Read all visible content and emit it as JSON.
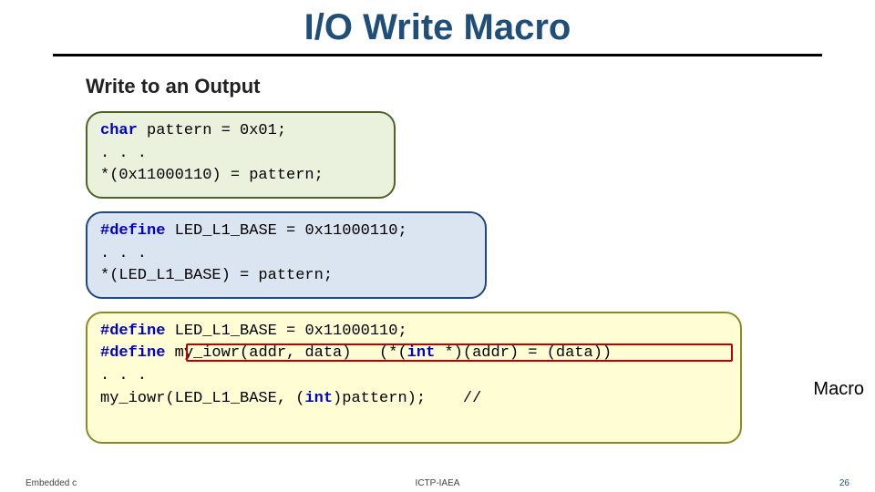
{
  "title": "I/O  Write Macro",
  "subhead": "Write to an Output",
  "code1": {
    "kw": "char",
    "rest1": " pattern = 0x01;",
    "line2": ". . .",
    "line3": "*(0x11000110) = pattern;"
  },
  "code2": {
    "kw": "#define",
    "rest1": " LED_L1_BASE = 0x11000110;",
    "line2": ". . .",
    "line3": "*(LED_L1_BASE) = pattern;"
  },
  "code3": {
    "kw1": "#define",
    "rest1": " LED_L1_BASE = 0x11000110;",
    "kw2": "#define",
    "rest2a": " my_iowr(addr, data)   (*(",
    "kw2b": "int",
    "rest2c": " *)(addr) = (data))",
    "line3": ". . .",
    "line4a": "my_iowr(LED_L1_BASE, (",
    "kw4": "int",
    "line4b": ")pattern);    //"
  },
  "macro_label": "Macro",
  "footer": {
    "left": "Embedded c",
    "middle": "ICTP-IAEA",
    "right": "26"
  }
}
